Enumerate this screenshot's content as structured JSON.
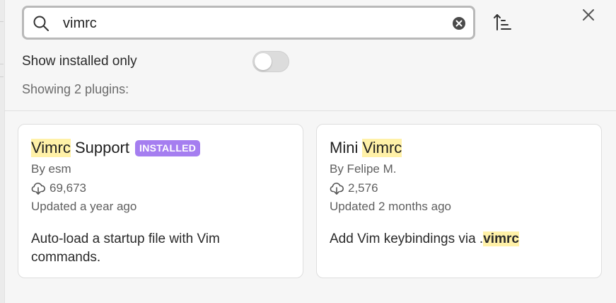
{
  "search": {
    "value": "vimrc",
    "placeholder": ""
  },
  "icons": {
    "search": "search-icon",
    "clear": "clear-circle-x-icon",
    "sort": "sort-ascending-icon",
    "close": "close-x-icon",
    "downloads": "download-cloud-icon"
  },
  "filters": {
    "show_installed_label": "Show installed only",
    "show_installed_on": false
  },
  "results": {
    "count_text": "Showing 2 plugins:"
  },
  "plugins": [
    {
      "title_highlight": "Vimrc",
      "title_rest": " Support",
      "badge": "INSTALLED",
      "author": "By esm",
      "downloads": "69,673",
      "updated": "Updated a year ago",
      "description": "Auto-load a startup file with Vim commands."
    },
    {
      "title_prefix": "Mini ",
      "title_highlight": "Vimrc",
      "author": "By Felipe M.",
      "downloads": "2,576",
      "updated": "Updated 2 months ago",
      "description_prefix": "Add Vim keybindings via .",
      "description_highlight": "vimrc"
    }
  ],
  "colors": {
    "highlight": "#fff1a8",
    "badge": "#a57ef0"
  }
}
